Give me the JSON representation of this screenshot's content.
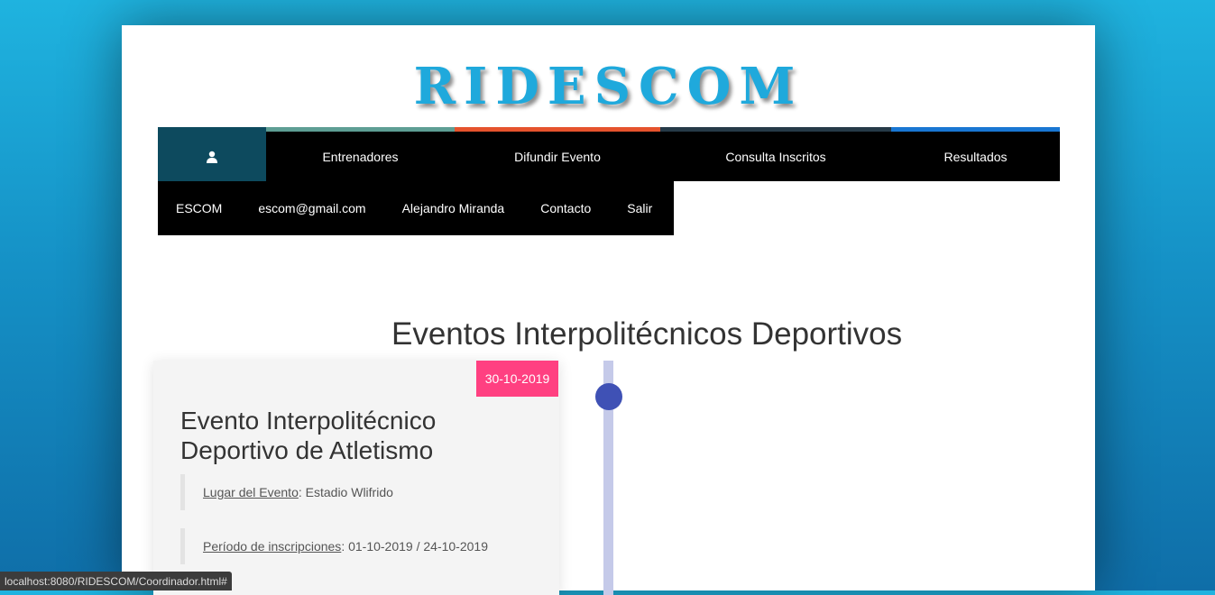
{
  "header": {
    "logo": "RIDESCOM"
  },
  "nav": {
    "user_icon": "user-icon",
    "primary": [
      "Entrenadores",
      "Difundir Evento",
      "Consulta Inscritos",
      "Resultados"
    ],
    "secondary": [
      "ESCOM",
      "escom@gmail.com",
      "Alejandro Miranda",
      "Contacto",
      "Salir"
    ],
    "accent_colors": [
      "#5e9e94",
      "#e5532d",
      "#263a48",
      "#1976d2"
    ]
  },
  "main": {
    "heading": "Eventos Interpolitécnicos Deportivos",
    "events": [
      {
        "date": "30-10-2019",
        "title": "Evento Interpolitécnico Deportivo de Atletismo",
        "place_label": "Lugar del Evento",
        "place_value": ": Estadio Wlifrido",
        "period_label": "Período de inscripciones",
        "period_value": ": 01-10-2019 / 24-10-2019"
      }
    ],
    "timeline_color": "#3f51b5",
    "badge_color": "#ff4081"
  },
  "statusbar": {
    "url": "localhost:8080/RIDESCOM/Coordinador.html#"
  }
}
